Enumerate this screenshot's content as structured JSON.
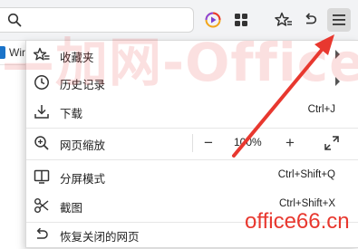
{
  "toolbar": {
    "search": {
      "value": "",
      "placeholder": ""
    },
    "icons": [
      "search-icon",
      "media-icon",
      "apps-grid-icon",
      "favorites-star-icon",
      "undo-icon",
      "menu-icon"
    ]
  },
  "bookmarks_bar": {
    "items": [
      {
        "label": "Wir"
      }
    ]
  },
  "menu": {
    "favorites": {
      "label": "收藏夹"
    },
    "history": {
      "label": "历史记录"
    },
    "downloads": {
      "label": "下载",
      "shortcut": "Ctrl+J"
    },
    "zoom": {
      "label": "网页缩放",
      "minus": "−",
      "value": "100%",
      "plus": "+"
    },
    "split_screen": {
      "label": "分屏模式",
      "shortcut": "Ctrl+Shift+Q"
    },
    "screenshot": {
      "label": "截图",
      "shortcut": "Ctrl+Shift+X"
    },
    "reopen_closed": {
      "label": "恢复关闭的网页"
    }
  },
  "overlay": {
    "watermark": "—加网-Office教程网",
    "site_stamp": "office66.cn",
    "arrow_color": "#e8382f"
  }
}
